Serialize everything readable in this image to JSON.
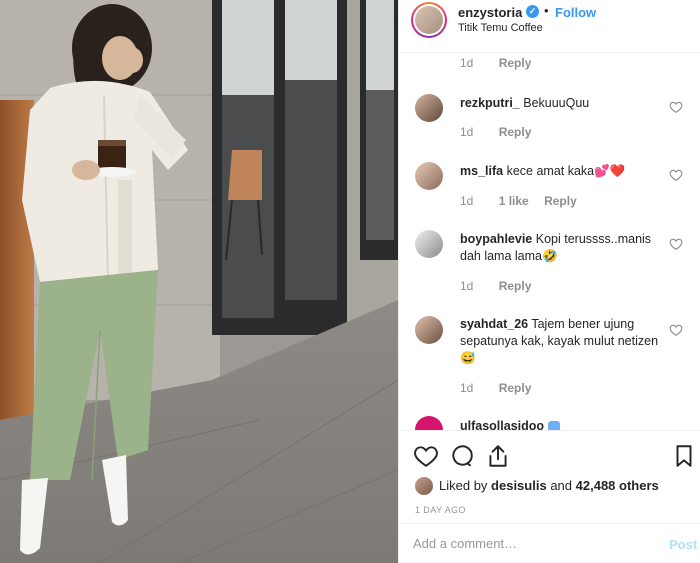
{
  "header": {
    "username": "enzystoria",
    "verified_mark": "✓",
    "separator": "•",
    "follow_label": "Follow",
    "location": "Titik Temu Coffee"
  },
  "comments": {
    "top_meta": {
      "time": "1d",
      "reply": "Reply"
    },
    "items": [
      {
        "username": "rezkputri_",
        "text": "BekuuuQuu",
        "time": "1d",
        "likes": "",
        "reply": "Reply"
      },
      {
        "username": "ms_lifa",
        "text": "kece amat kaka",
        "emoji": "💕❤️",
        "time": "1d",
        "likes": "1 like",
        "reply": "Reply"
      },
      {
        "username": "boypahlevie",
        "text": "Kopi terussss..manis dah lama lama",
        "emoji": "🤣",
        "time": "1d",
        "likes": "",
        "reply": "Reply"
      },
      {
        "username": "syahdat_26",
        "text": "Tajem bener ujung sepatunya kak, kayak mulut netizen",
        "emoji": "😅",
        "time": "1d",
        "likes": "",
        "reply": "Reply"
      },
      {
        "username": "ulfasollasidoo",
        "text": "",
        "time": "",
        "likes": "",
        "reply": ""
      }
    ]
  },
  "actions": {
    "icons": [
      "heart-icon",
      "comment-icon",
      "share-icon",
      "bookmark-icon"
    ],
    "liked_by_prefix": "Liked by",
    "liked_by_user": "desisulis",
    "liked_by_and": "and",
    "liked_by_count": "42,488 others",
    "timestamp": "1 DAY AGO"
  },
  "add_comment": {
    "placeholder": "Add a comment…",
    "post_label": "Post"
  },
  "colors": {
    "link_blue": "#3897f0",
    "post_disabled": "#b2dffc",
    "muted": "#8e8e8e",
    "border": "#efefef"
  }
}
